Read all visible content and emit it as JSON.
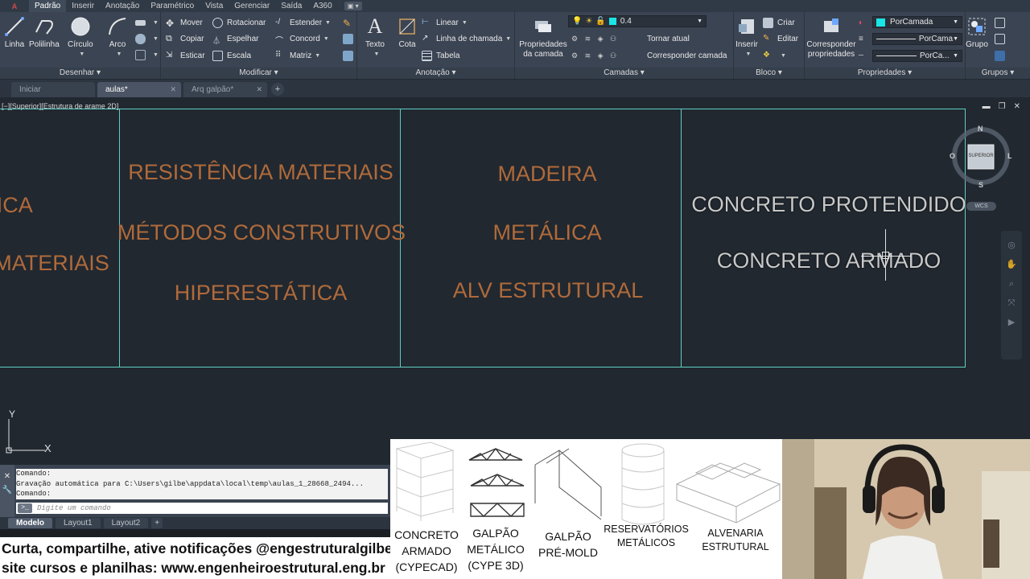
{
  "app_button": "A",
  "ribbon_tabs": [
    "Padrão",
    "Inserir",
    "Anotação",
    "Paramétrico",
    "Vista",
    "Gerenciar",
    "Saída",
    "A360"
  ],
  "panels": {
    "desenhar": {
      "title": "Desenhar",
      "linha": "Linha",
      "polilinha": "Polilinha",
      "circulo": "Círculo",
      "arco": "Arco"
    },
    "modificar": {
      "title": "Modificar",
      "mover": "Mover",
      "rotacionar": "Rotacionar",
      "estender": "Estender",
      "copiar": "Copiar",
      "espelhar": "Espelhar",
      "concord": "Concord",
      "esticar": "Esticar",
      "escala": "Escala",
      "matriz": "Matriz"
    },
    "anotacao": {
      "title": "Anotação",
      "texto": "Texto",
      "cota": "Cota",
      "linear": "Linear",
      "linha_chamada": "Linha de chamada",
      "tabela": "Tabela"
    },
    "camadas": {
      "title": "Camadas",
      "propriedades": "Propriedades",
      "da_camada": "da camada",
      "layer_value": "0.4",
      "tornar_atual": "Tornar atual",
      "corresponder_camada": "Corresponder camada"
    },
    "bloco": {
      "title": "Bloco",
      "inserir": "Inserir",
      "criar": "Criar",
      "editar": "Editar"
    },
    "propriedades": {
      "title": "Propriedades",
      "corresponder": "Corresponder",
      "propriedades": "propriedades",
      "color": "PorCamada",
      "linetype": "PorCama",
      "lineweight": "PorCa..."
    },
    "grupos": {
      "title": "Grupos",
      "grupo": "Grupo"
    }
  },
  "doc_tabs": [
    {
      "label": "Iniciar"
    },
    {
      "label": "aulas*"
    },
    {
      "label": "Arq galpão*"
    }
  ],
  "viewport_label": "[−][Superior][Estrutura de arame 2D]",
  "columns": {
    "col0": {
      "line1": "TICA",
      "line2": "MATERIAIS"
    },
    "col1": {
      "line1": "RESISTÊNCIA MATERIAIS",
      "line2": "MÉTODOS CONSTRUTIVOS",
      "line3": "HIPERESTÁTICA"
    },
    "col2": {
      "line1": "MADEIRA",
      "line2": "METÁLICA",
      "line3": "ALV ESTRUTURAL"
    },
    "col3": {
      "line1": "CONCRETO PROTENDIDO",
      "line2": "CONCRETO ARMADO"
    }
  },
  "viewcube": {
    "face": "SUPERIOR",
    "n": "N",
    "s": "S",
    "l": "L",
    "o": "O",
    "wcs": "WCS"
  },
  "ucs": {
    "x": "X",
    "y": "Y"
  },
  "command": {
    "history": [
      "Comando:",
      "Gravação automática para C:\\Users\\gilbe\\appdata\\local\\temp\\aulas_1_28668_2494...",
      "Comando:"
    ],
    "placeholder": "Digite um comando"
  },
  "layout_tabs": [
    "Modelo",
    "Layout1",
    "Layout2"
  ],
  "banner": {
    "line1": "Curta, compartilhe, ative notificações @engestruturalgilberto",
    "line2": "site cursos e planilhas: www.engenheiroestrutural.eng.br"
  },
  "thumbnails": [
    {
      "label1": "CONCRETO",
      "label2": "ARMADO",
      "label3": "(CYPECAD)"
    },
    {
      "label1": "GALPÃO",
      "label2": "METÁLICO",
      "label3": "(CYPE 3D)"
    },
    {
      "label1": "GALPÃO",
      "label2": "PRÉ-MOLD",
      "label3": ""
    },
    {
      "label1": "RESERVATÓRIOS",
      "label2": "METÁLICOS",
      "label3": ""
    },
    {
      "label1": "ALVENARIA",
      "label2": "ESTRUTURAL",
      "label3": ""
    }
  ],
  "colors": {
    "accent_frame": "#5fcfc2",
    "text_orange": "#b06a3a",
    "layer_swatch": "#19e6e6"
  }
}
